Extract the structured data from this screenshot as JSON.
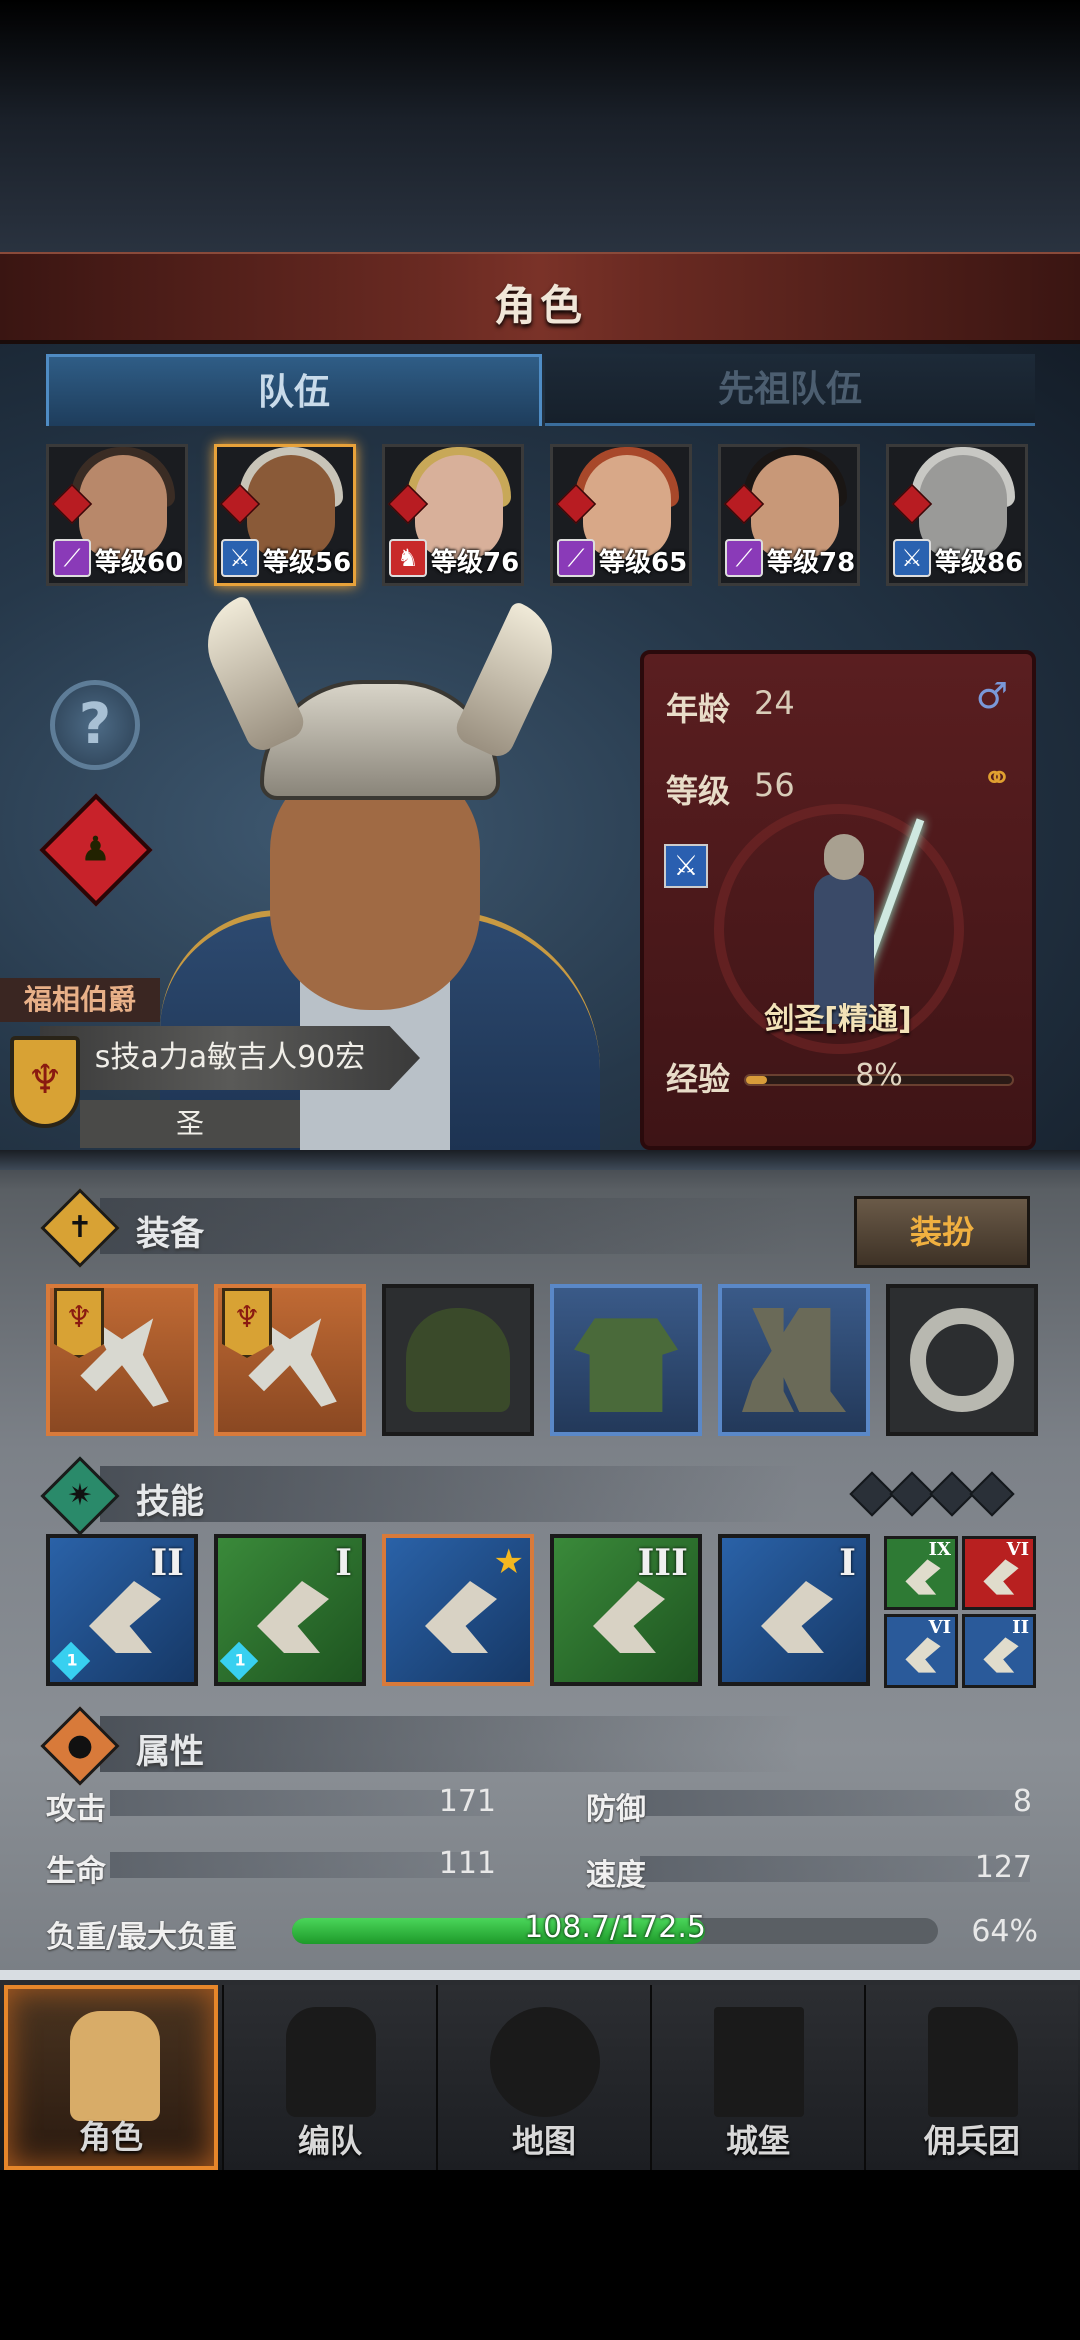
{
  "header": {
    "title": "角色"
  },
  "tabs": [
    {
      "label": "队伍"
    },
    {
      "label": "先祖队伍"
    }
  ],
  "party": [
    {
      "level_text": "等级60",
      "class_icon": "staff-icon",
      "class_color": "#8a3ab8",
      "skin": "#b8886a",
      "hair": "#3a2c24"
    },
    {
      "level_text": "等级56",
      "class_icon": "sword-icon",
      "class_color": "#2a62b0",
      "skin": "#8a5a38",
      "hair": "#c8c4b8"
    },
    {
      "level_text": "等级76",
      "class_icon": "beast-icon",
      "class_color": "#c82a2a",
      "skin": "#d8b09a",
      "hair": "#c8a858"
    },
    {
      "level_text": "等级65",
      "class_icon": "staff-icon",
      "class_color": "#8a3ab8",
      "skin": "#d8a888",
      "hair": "#a8482a"
    },
    {
      "level_text": "等级78",
      "class_icon": "staff-icon",
      "class_color": "#8a3ab8",
      "skin": "#c89878",
      "hair": "#1a1614"
    },
    {
      "level_text": "等级86",
      "class_icon": "sword-icon",
      "class_color": "#2a62b0",
      "skin": "#9a9a98",
      "hair": "#c8c8c4"
    }
  ],
  "character": {
    "title_tag": "福相伯爵",
    "name": "s技a力a敏吉人90宏",
    "sub": "圣",
    "age_label": "年龄",
    "age": "24",
    "level_label": "等级",
    "level": "56",
    "gender_icon": "male-icon",
    "ring_icon": "ring-icon",
    "class_name": "剑圣[精通]",
    "exp_label": "经验",
    "exp_pct": "8%",
    "exp_fraction": 0.08
  },
  "equipment": {
    "title": "装备",
    "dress_button": "装扮",
    "slots": [
      {
        "item": "halberd",
        "rarity": "orange",
        "flag": true
      },
      {
        "item": "halberd",
        "rarity": "orange",
        "flag": true
      },
      {
        "item": "hood",
        "rarity": "normal",
        "flag": false
      },
      {
        "item": "tunic",
        "rarity": "blue",
        "flag": false
      },
      {
        "item": "boots",
        "rarity": "blue",
        "flag": false
      },
      {
        "item": "ring",
        "rarity": "normal",
        "flag": false
      }
    ]
  },
  "skills": {
    "title": "技能",
    "main": [
      {
        "rank": "II",
        "color": "b",
        "badge": "1"
      },
      {
        "rank": "I",
        "color": "g",
        "badge": "1"
      },
      {
        "rank": "",
        "color": "o",
        "badge": "",
        "star": true
      },
      {
        "rank": "III",
        "color": "g",
        "badge": ""
      },
      {
        "rank": "I",
        "color": "b",
        "badge": ""
      }
    ],
    "mini": [
      {
        "rank": "IX",
        "color": "#2e7a34"
      },
      {
        "rank": "VI",
        "color": "#b82020"
      },
      {
        "rank": "VI",
        "color": "#2a5a9a"
      },
      {
        "rank": "II",
        "color": "#2a5a9a"
      }
    ]
  },
  "attributes": {
    "title": "属性",
    "attack_label": "攻击",
    "attack": "171",
    "defense_label": "防御",
    "defense": "8",
    "hp_label": "生命",
    "hp": "111",
    "speed_label": "速度",
    "speed": "127",
    "load_label": "负重/最大负重",
    "load": "108.7/172.5",
    "load_pct": "64%",
    "load_fraction": 0.64
  },
  "nav": [
    {
      "label": "角色"
    },
    {
      "label": "编队"
    },
    {
      "label": "地图"
    },
    {
      "label": "城堡"
    },
    {
      "label": "佣兵团"
    }
  ],
  "colors": {
    "accent": "#e6862a",
    "tab_blue": "#4f8cc4",
    "panel_red": "#5a1e20",
    "load_green": "#2ab43a"
  }
}
